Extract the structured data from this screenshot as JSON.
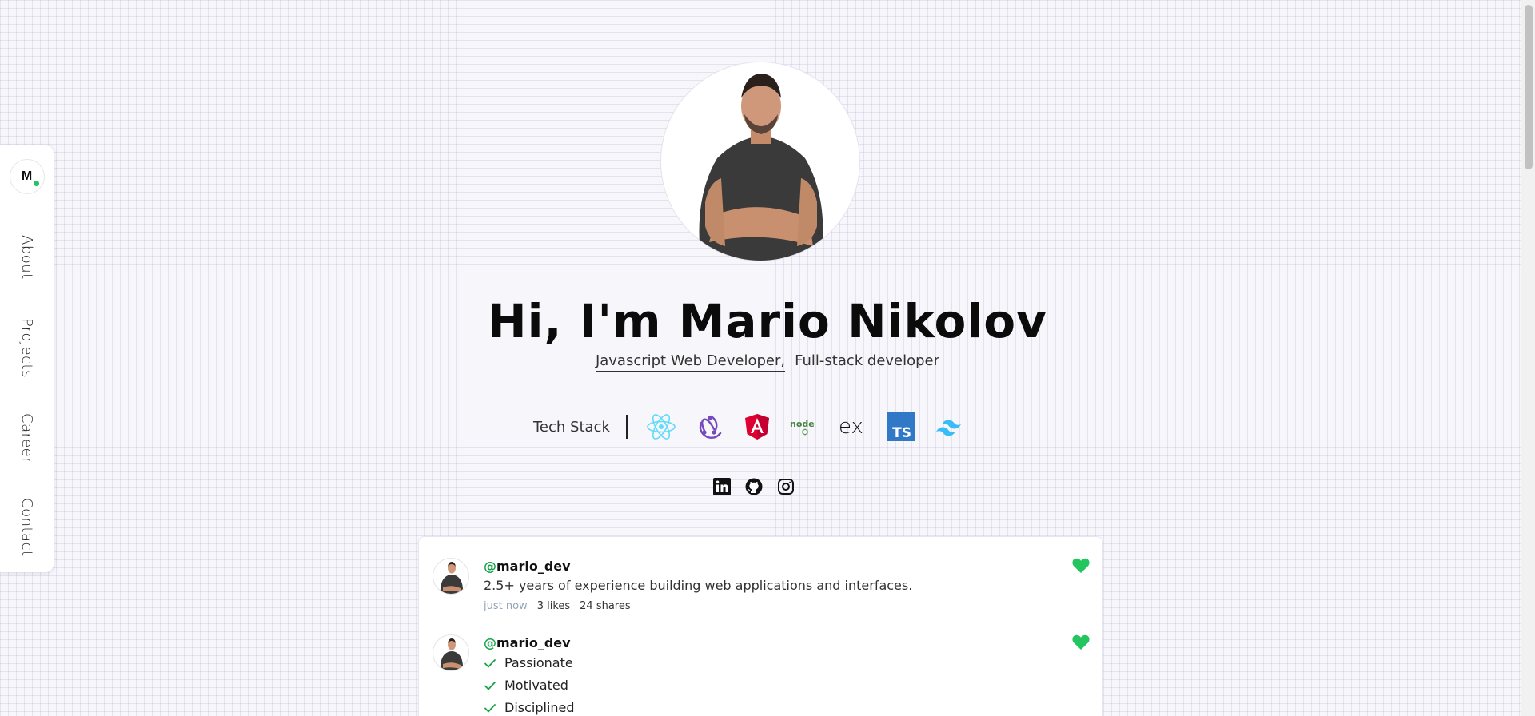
{
  "sidenav": {
    "logo_text": "M",
    "items": [
      {
        "label": "About"
      },
      {
        "label": "Projects"
      },
      {
        "label": "Career"
      },
      {
        "label": "Contact"
      }
    ]
  },
  "hero": {
    "title": "Hi, I'm Mario Nikolov",
    "roles": [
      "Javascript Web Developer,",
      "Full-stack developer"
    ],
    "tech_stack_label": "Tech Stack",
    "tech_icons": [
      "react-icon",
      "redux-icon",
      "angular-icon",
      "node-icon",
      "express-icon",
      "typescript-icon",
      "tailwind-icon"
    ],
    "ts_badge": "TS",
    "ex_label": "ex",
    "node_label": "node",
    "social_icons": [
      "linkedin-icon",
      "github-icon",
      "instagram-icon"
    ]
  },
  "feed": {
    "posts": [
      {
        "handle_at": "@",
        "handle": "mario_dev",
        "text": "2.5+ years of experience building web applications and interfaces.",
        "time": "just now",
        "likes": "3 likes",
        "shares": "24 shares"
      },
      {
        "handle_at": "@",
        "handle": "mario_dev",
        "checklist": [
          "Passionate",
          "Motivated",
          "Disciplined"
        ]
      }
    ]
  },
  "colors": {
    "accent_green": "#22c55e",
    "react": "#61dafb",
    "redux": "#764abc",
    "angular": "#dd0031",
    "node": "#43853d",
    "typescript": "#3178c6",
    "tailwind": "#38bdf8"
  }
}
